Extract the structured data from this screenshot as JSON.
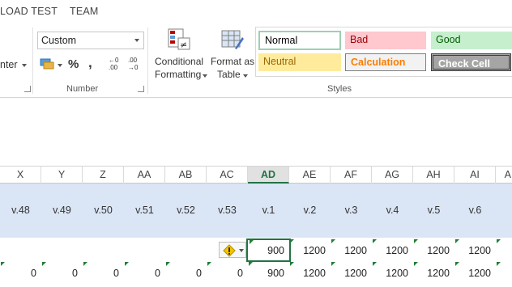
{
  "ribbon_tabs": [
    "LOAD TEST",
    "TEAM"
  ],
  "number_group": {
    "format_value": "Custom",
    "percent_symbol": "%",
    "comma_symbol": ",",
    "inc_decimal_top": "←0",
    "inc_decimal_bottom": ".00",
    "dec_decimal_top": ".00",
    "dec_decimal_bottom": "→0",
    "label": "Number"
  },
  "alignment_group": {
    "partial_label": "nter"
  },
  "styles_group": {
    "conditional_formatting": [
      "Conditional",
      "Formatting"
    ],
    "format_as_table": [
      "Format as",
      "Table"
    ],
    "normal": "Normal",
    "bad": "Bad",
    "good": "Good",
    "neutral": "Neutral",
    "calculation": "Calculation",
    "check_cell": "Check Cell",
    "label": "Styles"
  },
  "columns": [
    "X",
    "Y",
    "Z",
    "AA",
    "AB",
    "AC",
    "AD",
    "AE",
    "AF",
    "AG",
    "AH",
    "AI",
    "A"
  ],
  "selected_column": "AD",
  "header_row": [
    "v.48",
    "v.49",
    "v.50",
    "v.51",
    "v.52",
    "v.53",
    "v.1",
    "v.2",
    "v.3",
    "v.4",
    "v.5",
    "v.6"
  ],
  "row1": [
    "",
    "",
    "",
    "",
    "",
    "",
    "900",
    "1200",
    "1200",
    "1200",
    "1200",
    "1200"
  ],
  "row2": [
    "0",
    "0",
    "0",
    "0",
    "0",
    "0",
    "900",
    "1200",
    "1200",
    "1200",
    "1200",
    "1200"
  ],
  "colors": {
    "accent_green": "#217346",
    "header_blue": "#dae5f5",
    "bad_bg": "#ffc7ce",
    "bad_text": "#9c0006",
    "good_bg": "#c6efce",
    "good_text": "#006100",
    "neutral_bg": "#ffeb9c",
    "neutral_text": "#9c6500",
    "calc_bg": "#f2f2f2",
    "calc_text": "#fa7d00",
    "check_bg": "#a5a5a5"
  }
}
